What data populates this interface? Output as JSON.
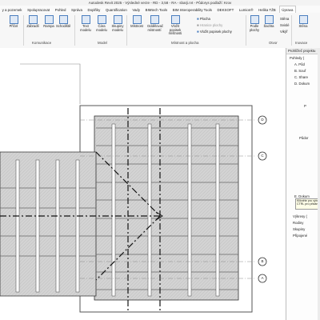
{
  "window": {
    "title": "Autodesk Revit 2025 - Výsledné verze - RD - 3,58 - RA - sbarji.rvt - Půdorys podlaží: Krov"
  },
  "menu": {
    "items": [
      "y a pozemek",
      "Spolupracovat",
      "Pohled",
      "Správa",
      "Doplňky",
      "Quantification",
      "Vady",
      "BIMtech Tools",
      "BIM Interoperability Tools",
      "DEKSOFT",
      "Lumion®",
      "Helika TŽB",
      "Úprava"
    ],
    "active_index": 12
  },
  "ribbon": {
    "buttons": [
      {
        "label": "Příčel"
      },
      {
        "label": "Zábradlí"
      },
      {
        "label": "Rampa"
      },
      {
        "label": "Schodiště"
      },
      {
        "label": "Text modelu"
      },
      {
        "label": "Čára modelu"
      },
      {
        "label": "Skupiny modelu"
      },
      {
        "label": "Místnost"
      },
      {
        "label": "Oddělovač místností"
      },
      {
        "label": "Vložit popisek místnosti"
      },
      {
        "label": "Podle plochy"
      },
      {
        "label": "Šachta"
      },
      {
        "label": "Stěna"
      }
    ],
    "small_items": {
      "plocha": "Plocha",
      "hranice_plochy": "Hranice plochy",
      "vlozit_popisek_plochy": "Vložit popisek plochy",
      "svisle": "Svislé",
      "vikyr": "Vikýř",
      "stena_label": "Stěna"
    },
    "groups": {
      "komunikace": "Komunikace",
      "model": "Model",
      "mistnost_plocha": "Místnost a plocha",
      "otvor": "Otvor",
      "inovace": "Inovace"
    }
  },
  "canvas": {
    "grid_bubbles": [
      "D",
      "C",
      "B",
      "A"
    ]
  },
  "project_browser": {
    "title": "Prohlížeč projektu",
    "items": [
      "Pohledy (",
      "A. Půd",
      "B. Souř",
      "C. Share",
      "D. Dokum",
      "P",
      "Půdor",
      "E. Dokum",
      "Výkresy (",
      "Rodiny",
      "Skupiny",
      "Připojené"
    ],
    "tooltip": [
      "Klikněte pro výběr, stiskněte",
      "CTRL pro přidání, SHIFT"
    ]
  },
  "colors": {
    "accent": "#4c7fbf",
    "hatch": "#d3d3d3",
    "panel": "#f7f7f7"
  }
}
